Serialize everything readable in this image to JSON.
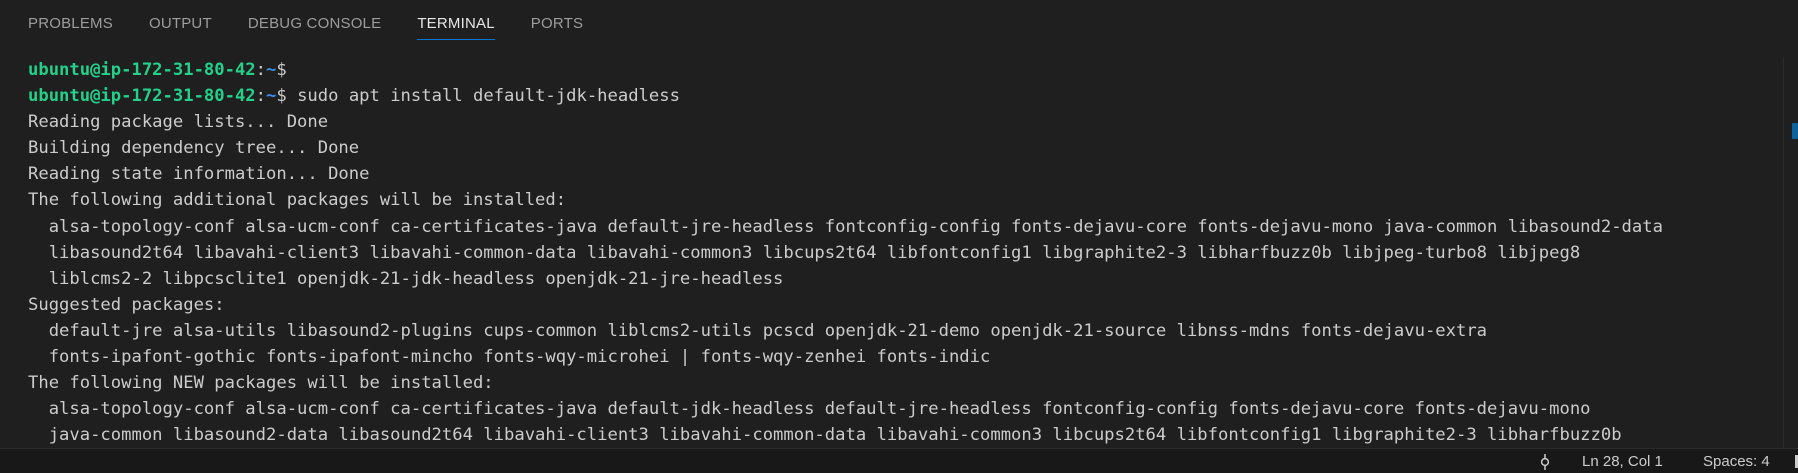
{
  "panel": {
    "tabs": [
      {
        "label": "PROBLEMS",
        "active": false
      },
      {
        "label": "OUTPUT",
        "active": false
      },
      {
        "label": "DEBUG CONSOLE",
        "active": false
      },
      {
        "label": "TERMINAL",
        "active": true
      },
      {
        "label": "PORTS",
        "active": false
      }
    ]
  },
  "terminal": {
    "prompt": {
      "user_host": "ubuntu@ip-172-31-80-42",
      "separator": ":",
      "path": "~",
      "symbol": "$"
    },
    "command": " sudo apt install default-jdk-headless",
    "output": [
      "Reading package lists... Done",
      "Building dependency tree... Done",
      "Reading state information... Done",
      "The following additional packages will be installed:",
      "  alsa-topology-conf alsa-ucm-conf ca-certificates-java default-jre-headless fontconfig-config fonts-dejavu-core fonts-dejavu-mono java-common libasound2-data",
      "  libasound2t64 libavahi-client3 libavahi-common-data libavahi-common3 libcups2t64 libfontconfig1 libgraphite2-3 libharfbuzz0b libjpeg-turbo8 libjpeg8",
      "  liblcms2-2 libpcsclite1 openjdk-21-jdk-headless openjdk-21-jre-headless",
      "Suggested packages:",
      "  default-jre alsa-utils libasound2-plugins cups-common liblcms2-utils pcscd openjdk-21-demo openjdk-21-source libnss-mdns fonts-dejavu-extra",
      "  fonts-ipafont-gothic fonts-ipafont-mincho fonts-wqy-microhei | fonts-wqy-zenhei fonts-indic",
      "The following NEW packages will be installed:",
      "  alsa-topology-conf alsa-ucm-conf ca-certificates-java default-jdk-headless default-jre-headless fontconfig-config fonts-dejavu-core fonts-dejavu-mono",
      "  java-common libasound2-data libasound2t64 libavahi-client3 libavahi-common-data libavahi-common3 libcups2t64 libfontconfig1 libgraphite2-3 libharfbuzz0b"
    ]
  },
  "statusbar": {
    "branch_icon": "git-branch-icon",
    "position": "Ln 28, Col 1",
    "spaces": "Spaces: 4"
  },
  "colors": {
    "prompt_user": "#23d18b",
    "prompt_path": "#3b8eea",
    "text": "#cccccc",
    "background": "#1f1f1f",
    "active_tab_underline": "#0078d4"
  }
}
